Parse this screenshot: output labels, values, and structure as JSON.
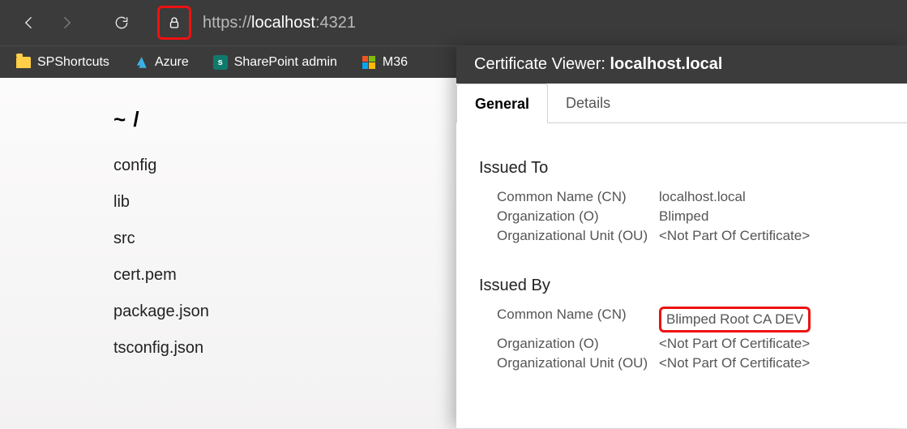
{
  "browser": {
    "url_scheme": "https://",
    "url_host": "localhost",
    "url_port": ":4321",
    "bookmarks": [
      {
        "label": "SPShortcuts",
        "icon": "folder"
      },
      {
        "label": "Azure",
        "icon": "azure"
      },
      {
        "label": "SharePoint admin",
        "icon": "sharepoint"
      },
      {
        "label": "M36",
        "icon": "microsoft"
      }
    ]
  },
  "page": {
    "heading": "~ /",
    "files": [
      "config",
      "lib",
      "src",
      "cert.pem",
      "package.json",
      "tsconfig.json"
    ]
  },
  "cert": {
    "panel_title_prefix": "Certificate Viewer: ",
    "panel_title_subject": "localhost.local",
    "tabs": {
      "general": "General",
      "details": "Details"
    },
    "issued_to_label": "Issued To",
    "issued_by_label": "Issued By",
    "fields": {
      "cn": "Common Name (CN)",
      "o": "Organization (O)",
      "ou": "Organizational Unit (OU)"
    },
    "issued_to": {
      "cn": "localhost.local",
      "o": "Blimped",
      "ou": "<Not Part Of Certificate>"
    },
    "issued_by": {
      "cn": "Blimped Root CA DEV",
      "o": "<Not Part Of Certificate>",
      "ou": "<Not Part Of Certificate>"
    }
  }
}
